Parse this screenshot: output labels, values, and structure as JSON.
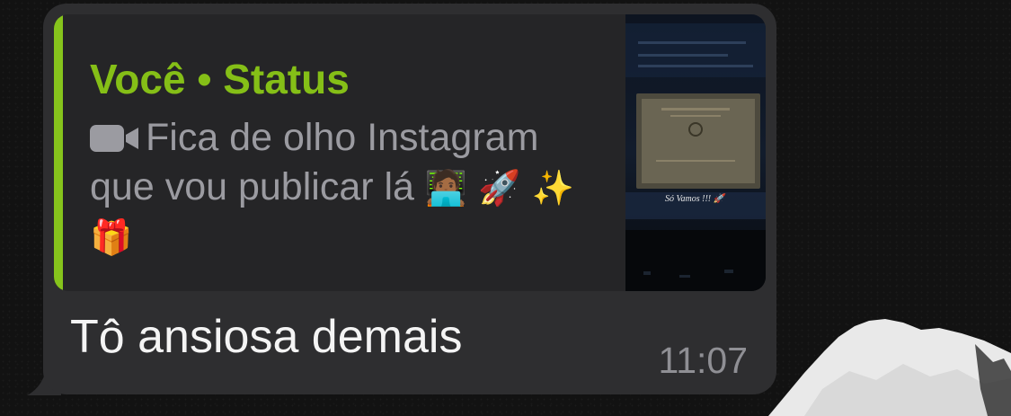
{
  "reply_quote": {
    "author": "Você • Status",
    "media_icon": "video-camera-icon",
    "text": "Fica de olho Instagram que vou publicar lá",
    "emojis": [
      "🧑🏾‍💻",
      "🚀",
      "✨",
      "🎁"
    ],
    "thumbnail_caption": "Só Vamos !!! 🚀",
    "accent_color": "#86c41c"
  },
  "message": {
    "text": "Tô ansiosa demais",
    "time": "11:07"
  }
}
